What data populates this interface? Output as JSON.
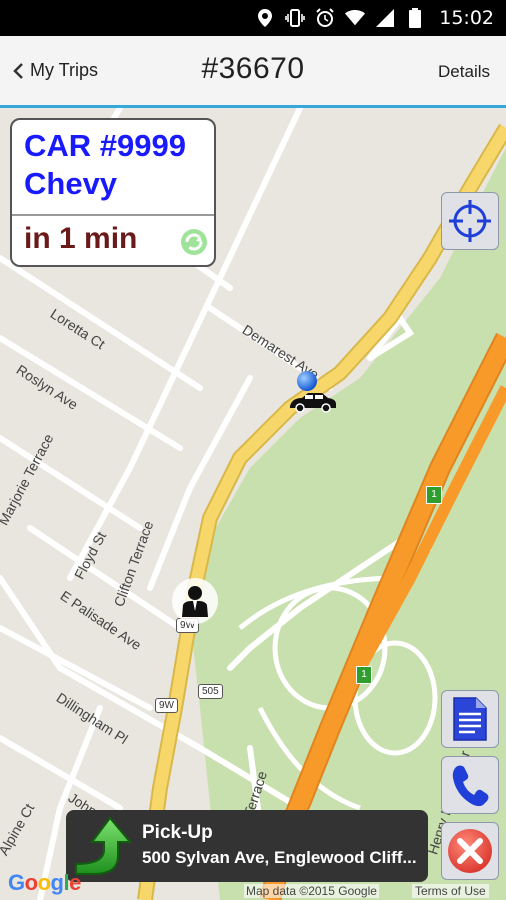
{
  "status_bar": {
    "time": "15:02",
    "icons": [
      "location-icon",
      "vibrate-icon",
      "alarm-icon",
      "wifi-icon",
      "signal-icon",
      "battery-icon"
    ]
  },
  "header": {
    "back_label": "My Trips",
    "title": "#36670",
    "details_label": "Details"
  },
  "car_card": {
    "car_number": "CAR #9999",
    "model": "Chevy",
    "eta": "in 1 min"
  },
  "map": {
    "streets": [
      {
        "label": "Loretta Ct"
      },
      {
        "label": "Roslyn Ave"
      },
      {
        "label": "Marjorie Terrace"
      },
      {
        "label": "Demarest Ave"
      },
      {
        "label": "Floyd St"
      },
      {
        "label": "Clifton Terrace"
      },
      {
        "label": "E Palisade Ave"
      },
      {
        "label": "Dillingham Pl"
      },
      {
        "label": "John St"
      },
      {
        "label": "Alpine Ct"
      },
      {
        "label": "Terrace"
      },
      {
        "label": "Henry Hudson Dr"
      }
    ],
    "route_shields": [
      "9W",
      "9W",
      "505"
    ],
    "highway_badges": [
      "1",
      "1"
    ],
    "google_logo": "Google",
    "credit": "Map data ©2015 Google",
    "terms": "Terms of Use",
    "colors": {
      "land": "#e8e6df",
      "park": "#c8dfae",
      "highway": "#f79a2a",
      "major_road": "#f7d76a",
      "road": "#ffffff"
    }
  },
  "side_buttons": [
    "my-location",
    "document",
    "call",
    "cancel"
  ],
  "pickup": {
    "title": "Pick-Up",
    "address": "500 Sylvan Ave, Englewood Cliff..."
  },
  "accent": "#35a7d8"
}
